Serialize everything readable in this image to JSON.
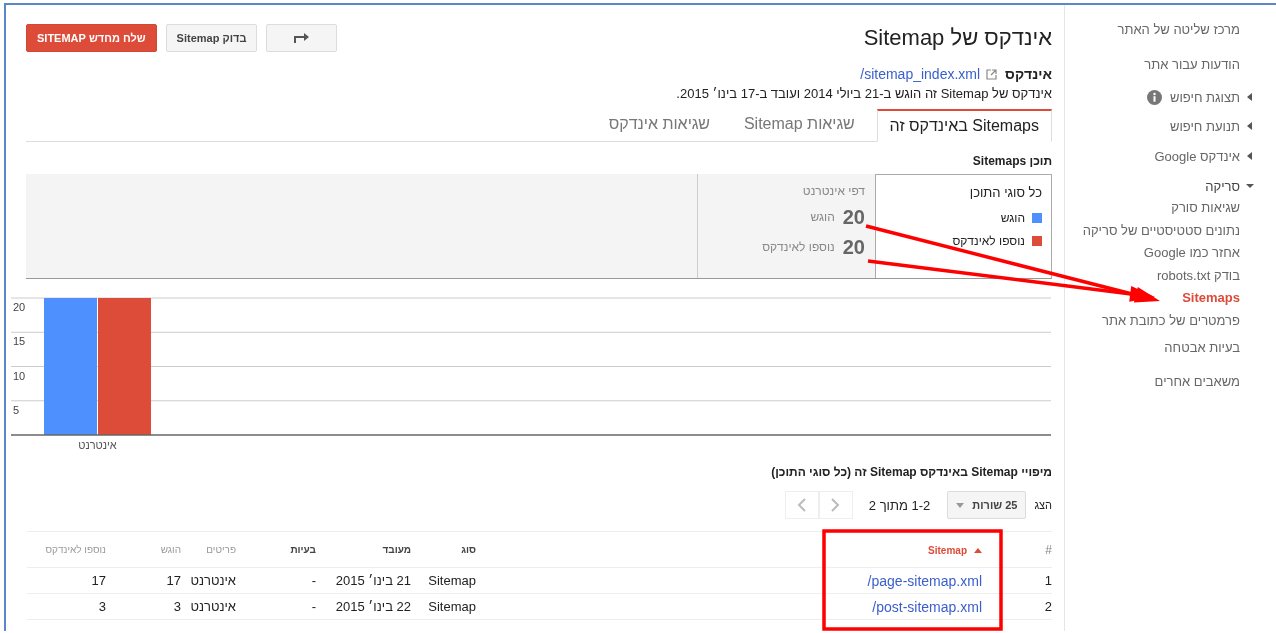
{
  "sidebar": {
    "items": [
      {
        "label": "מרכז שליטה של האתר",
        "kind": "link",
        "selected": false
      },
      {
        "label": "הודעות עבור אתר",
        "kind": "link",
        "selected": false
      },
      {
        "label": "תצוגת חיפוש",
        "kind": "group",
        "expanded": false,
        "info": true,
        "selected": false
      },
      {
        "label": "תנועת חיפוש",
        "kind": "group",
        "expanded": false,
        "selected": false
      },
      {
        "label": "אינדקס Google",
        "kind": "group",
        "expanded": false,
        "selected": false
      },
      {
        "label": "סריקה",
        "kind": "group",
        "expanded": true,
        "selected": false,
        "children": [
          {
            "label": "שגיאות סורק",
            "selected": false
          },
          {
            "label": "נתונים סטטיסטיים של סריקה",
            "selected": false
          },
          {
            "label": "אחזר כמו Google",
            "selected": false
          },
          {
            "label": "בודק robots.txt",
            "selected": false
          },
          {
            "label": "Sitemaps",
            "selected": true
          },
          {
            "label": "פרמטרים של כתובת אתר",
            "selected": false
          }
        ]
      },
      {
        "label": "בעיות אבטחה",
        "kind": "link",
        "selected": false
      },
      {
        "label": "משאבים אחרים",
        "kind": "link",
        "selected": false
      }
    ]
  },
  "page": {
    "title": "אינדקס של Sitemap",
    "buttons": [
      {
        "kind": "share"
      },
      {
        "kind": "default",
        "label": "בדוק Sitemap"
      },
      {
        "kind": "primary",
        "label": "שלח מחדש SITEMAP"
      }
    ],
    "index_label": "אינדקס",
    "index_url": "/sitemap_index.xml",
    "description": "אינדקס של Sitemap זה הוגש ב-21 ביולי 2014 ועובד ב-17 בינו׳ 2015."
  },
  "tabs": [
    {
      "label": "Sitemaps באינדקס זה",
      "selected": true
    },
    {
      "label": "שגיאות Sitemap",
      "selected": false
    },
    {
      "label": "שגיאות אינדקס",
      "selected": false
    }
  ],
  "content": {
    "title": "תוכן Sitemaps",
    "legend": {
      "title": "כל סוגי התוכן"
    },
    "stats": {
      "heading": "דפי אינטרנט",
      "rows": [
        {
          "value": "20",
          "label": "הוגש"
        },
        {
          "value": "20",
          "label": "נוספו לאינדקס"
        }
      ]
    },
    "chart_data": {
      "type": "bar",
      "categories": [
        "אינטרנט"
      ],
      "series": [
        {
          "name": "הוגש",
          "color": "#4d90fe",
          "values": [
            20
          ]
        },
        {
          "name": "נוספו לאינדקס",
          "color": "#dd4b39",
          "values": [
            20
          ]
        }
      ],
      "ylim": [
        0,
        20
      ],
      "yticks": [
        5,
        10,
        15,
        20
      ],
      "grid": true
    }
  },
  "mappings": {
    "title": "מיפויי Sitemap באינדקס Sitemap זה (כל סוגי התוכן)",
    "show_label": "הצג",
    "rows_per_page": "25 שורות",
    "range": "1-2 מתוך 2",
    "pager": [
      {
        "kind": "previous",
        "disabled": true
      },
      {
        "kind": "next",
        "disabled": true
      }
    ],
    "columns": [
      {
        "label": "#",
        "kind": "text",
        "sorted": false
      },
      {
        "label": "Sitemap",
        "kind": "link",
        "sorted": true
      },
      {
        "label": "סוג",
        "kind": "text",
        "sorted": false
      },
      {
        "label": "מעובד",
        "kind": "text",
        "sorted": false
      },
      {
        "label": "בעיות",
        "kind": "text",
        "sorted": false
      },
      {
        "label": "פריטים",
        "kind": "text",
        "sorted": false
      },
      {
        "label": "הוגש",
        "kind": "text",
        "sorted": false
      },
      {
        "label": "נוספו לאינדקס",
        "kind": "text",
        "sorted": false
      }
    ],
    "rows": [
      [
        "1",
        "/page-sitemap.xml",
        "Sitemap",
        "21 בינו׳ 2015",
        "-",
        "אינטרנט",
        "17",
        "17"
      ],
      [
        "2",
        "/post-sitemap.xml",
        "Sitemap",
        "22 בינו׳ 2015",
        "-",
        "אינטרנט",
        "3",
        "3"
      ]
    ]
  }
}
